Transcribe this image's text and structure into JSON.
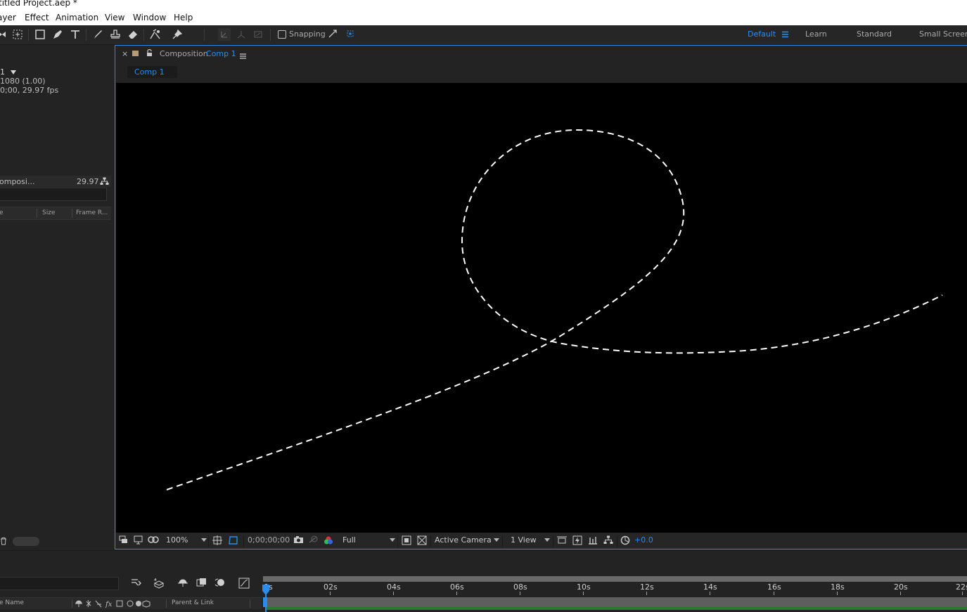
{
  "window": {
    "title": "titled Project.aep *"
  },
  "menu": [
    "ayer",
    "Effect",
    "Animation",
    "View",
    "Window",
    "Help"
  ],
  "toolbar": {
    "snapping_label": "Snapping",
    "workspaces": [
      "Default",
      "Learn",
      "Standard",
      "Small Screen"
    ],
    "active_workspace": "Default"
  },
  "project": {
    "comp_name_partial": "1",
    "info_line1": "1080 (1.00)",
    "info_line2": "0;00, 29.97 fps",
    "columns": [
      "e",
      "Size",
      "Frame R..."
    ],
    "item": {
      "type": "omposi...",
      "frame_rate": "29.97"
    }
  },
  "composition": {
    "panel_prefix": "Composition",
    "name": "Comp 1",
    "tab": "Comp 1"
  },
  "viewer_footer": {
    "zoom": "100%",
    "timecode": "0;00;00;00",
    "resolution": "Full",
    "camera": "Active Camera",
    "views": "1 View",
    "exposure": "+0.0"
  },
  "timeline": {
    "ticks": [
      "0s",
      "02s",
      "04s",
      "06s",
      "08s",
      "10s",
      "12s",
      "14s",
      "16s",
      "18s",
      "20s",
      "22s"
    ],
    "layer_name_header": "e Name",
    "parent_header": "Parent & Link"
  },
  "colors": {
    "accent": "#2d8ceb",
    "panel_bg": "#232323",
    "viewer_bg": "#000000"
  }
}
